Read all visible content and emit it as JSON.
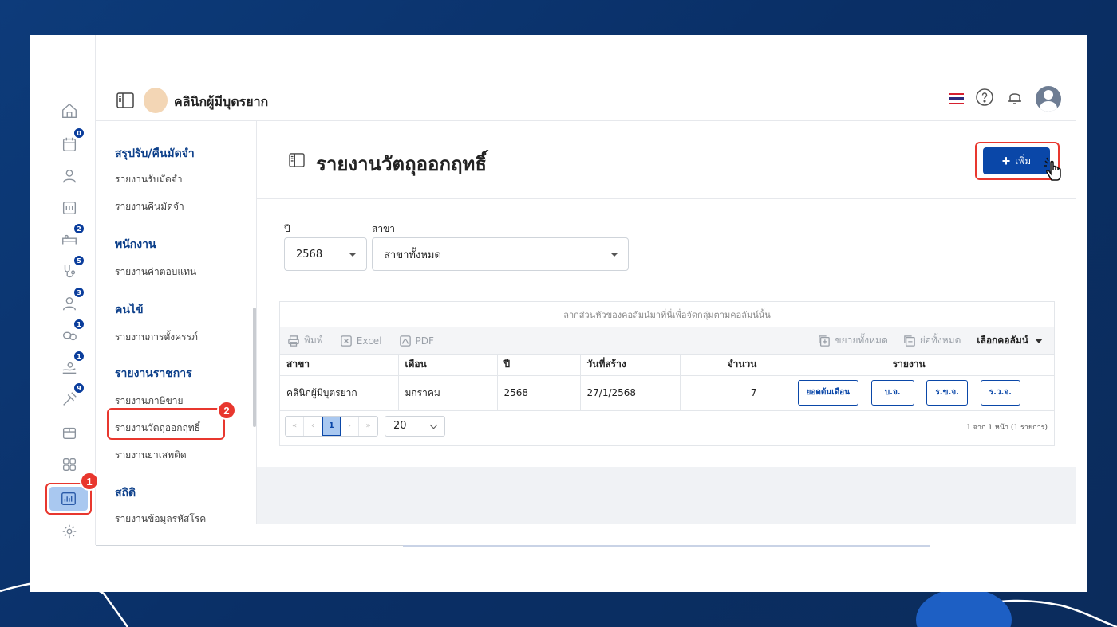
{
  "brand": {
    "name": "คลินิกผู้มีบุตรยาก"
  },
  "rail": {
    "badges": [
      "0",
      "2",
      "5",
      "3",
      "1",
      "1",
      "9"
    ]
  },
  "markers": {
    "first": "1",
    "second": "2"
  },
  "sidebar": {
    "sections": [
      {
        "title": "สรุปรับ/คืนมัดจำ",
        "links": [
          "รายงานรับมัดจำ",
          "รายงานคืนมัดจำ"
        ]
      },
      {
        "title": "พนักงาน",
        "links": [
          "รายงานค่าตอบแทน"
        ]
      },
      {
        "title": "คนไข้",
        "links": [
          "รายงานการตั้งครรภ์"
        ]
      },
      {
        "title": "รายงานราชการ",
        "links": [
          "รายงานภาษีขาย",
          "รายงานวัตถุออกฤทธิ์",
          "รายงานยาเสพติด"
        ]
      },
      {
        "title": "สถิติ",
        "links": [
          "รายงานข้อมูลรหัสโรค"
        ]
      }
    ]
  },
  "page": {
    "title": "รายงานวัตถุออกฤทธิ์",
    "add_label": "เพิ่ม"
  },
  "filters": {
    "year_label": "ปี",
    "year_value": "2568",
    "branch_label": "สาขา",
    "branch_value": "สาขาทั้งหมด"
  },
  "grid": {
    "group_hint": "ลากส่วนหัวของคอลัมน์มาที่นี่เพื่อจัดกลุ่มตามคอลัมน์นั้น",
    "toolbar": {
      "print": "พิมพ์",
      "excel": "Excel",
      "pdf": "PDF",
      "expand_all": "ขยายทั้งหมด",
      "collapse_all": "ย่อทั้งหมด",
      "column_chooser": "เลือกคอลัมน์"
    },
    "columns": [
      "สาขา",
      "เดือน",
      "ปี",
      "วันที่สร้าง",
      "จำนวน",
      "รายงาน"
    ],
    "rows": [
      {
        "branch": "คลินิกผู้มีบุตรยาก",
        "month": "มกราคม",
        "year": "2568",
        "created": "27/1/2568",
        "qty": "7",
        "reports": [
          "ยอดต้นเดือน",
          "บ.จ.",
          "ร.ข.จ.",
          "ร.ว.จ."
        ]
      }
    ],
    "pager": {
      "first": "«",
      "prev": "‹",
      "current": "1",
      "next": "›",
      "last": "»",
      "page_size": "20",
      "info": "1 จาก 1 หน้า (1 รายการ)"
    }
  },
  "colors": {
    "primary": "#0a47a8",
    "accent_red": "#e8372e",
    "section_title": "#0c3f8a",
    "background": "#0d3b7a"
  }
}
